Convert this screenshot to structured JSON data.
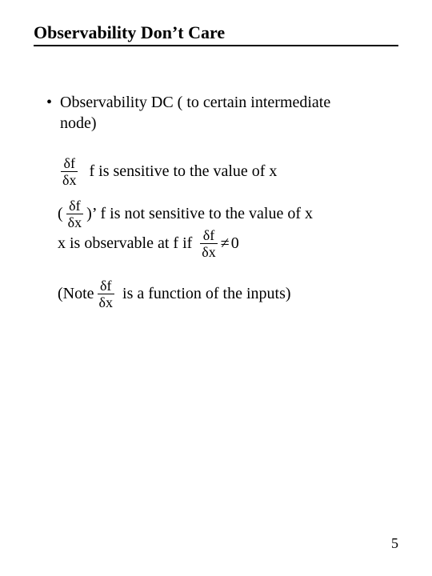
{
  "title": "Observability Don’t Care",
  "bullet": {
    "marker": "•",
    "text_a": "Observability DC ( to certain intermediate",
    "text_b": "node)"
  },
  "frac": {
    "num": "δf",
    "den": "δx"
  },
  "line1_text": "f is sensitive to the value of x",
  "line2": {
    "open": "(",
    "close_prime": ")’",
    "text": "f is not sensitive to the value of x"
  },
  "line3": {
    "pre": "x is observable at f if",
    "tail": "0",
    "neq": "≠"
  },
  "line4": {
    "pre": "(Note",
    "post": "is a function of the inputs)"
  },
  "pagenum": "5"
}
